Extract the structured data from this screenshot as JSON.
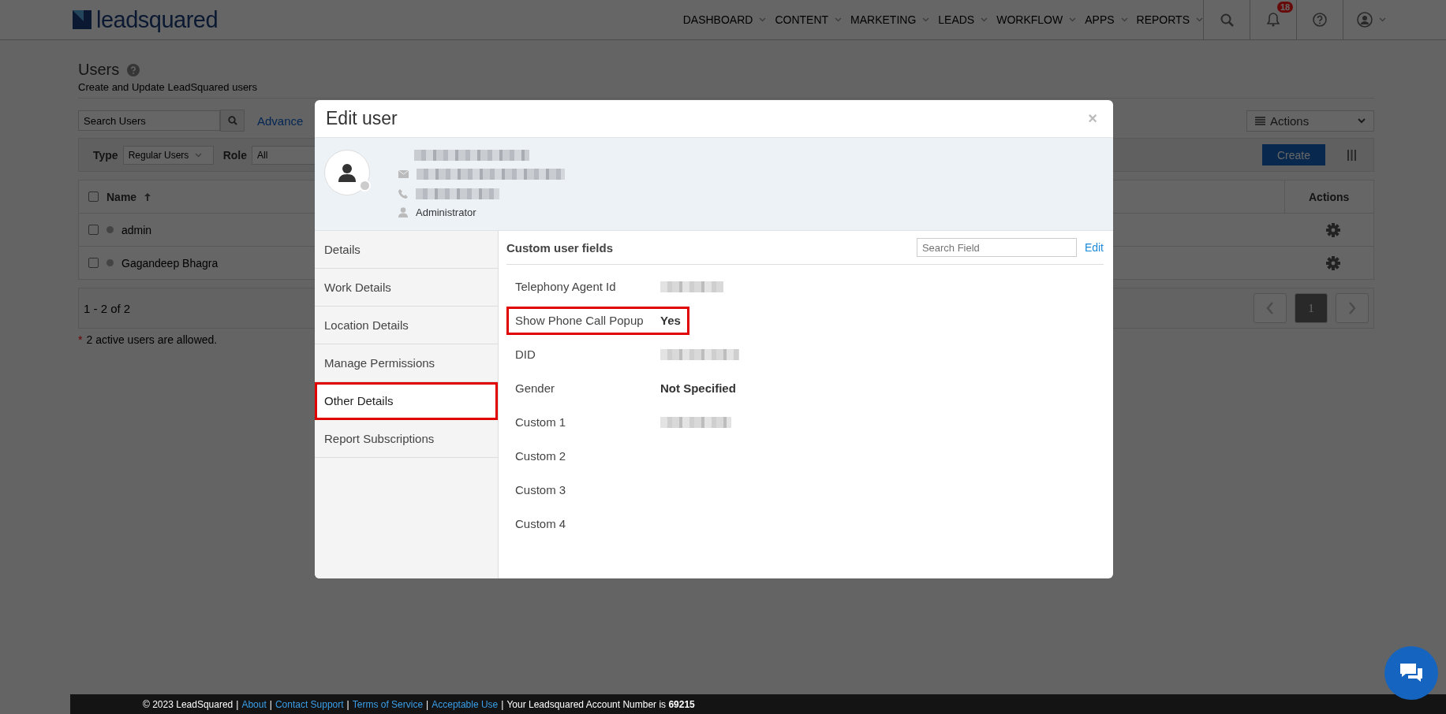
{
  "nav": {
    "brand": "leadsquared",
    "items": [
      {
        "label": "DASHBOARD"
      },
      {
        "label": "CONTENT"
      },
      {
        "label": "MARKETING"
      },
      {
        "label": "LEADS"
      },
      {
        "label": "WORKFLOW"
      },
      {
        "label": "APPS"
      },
      {
        "label": "REPORTS"
      }
    ],
    "notifications": "18"
  },
  "page": {
    "title": "Users",
    "subtitle": "Create and Update LeadSquared users",
    "search": {
      "placeholder": "Search Users"
    },
    "advanced_link": "Advance",
    "actions_menu": "Actions",
    "filters": [
      {
        "label": "Type",
        "value": "Regular Users"
      },
      {
        "label": "Role",
        "value": "All"
      }
    ],
    "create_button": "Create",
    "table": {
      "select_all": {
        "checked": false
      },
      "columns": [
        "Name",
        "Actions"
      ],
      "rows": [
        {
          "name": "admin",
          "checked": false
        },
        {
          "name": "Gagandeep Bhagra",
          "checked": false
        }
      ]
    },
    "range": "1 - 2 of 2",
    "pages": [
      {
        "label": "1",
        "selected": true
      }
    ],
    "note_mark": "*",
    "note": "2 active users are allowed."
  },
  "modal": {
    "title": "Edit user",
    "close": "×",
    "profile": {
      "lines": [
        {
          "kind": "name",
          "redacted": true
        },
        {
          "kind": "email",
          "redacted": true
        },
        {
          "kind": "phone",
          "redacted": true
        },
        {
          "kind": "role",
          "redacted": false,
          "text": "Administrator"
        }
      ]
    },
    "tabs": [
      {
        "label": "Details",
        "selected": false,
        "highlighted": false
      },
      {
        "label": "Work Details",
        "selected": false,
        "highlighted": false
      },
      {
        "label": "Location Details",
        "selected": false,
        "highlighted": false
      },
      {
        "label": "Manage Permissions",
        "selected": false,
        "highlighted": false
      },
      {
        "label": "Other Details",
        "selected": true,
        "highlighted": true
      },
      {
        "label": "Report Subscriptions",
        "selected": false,
        "highlighted": false
      }
    ],
    "panel": {
      "title": "Custom user fields",
      "search": {
        "placeholder": "Search Field"
      },
      "edit_link": "Edit",
      "fields": [
        {
          "label": "Telephony Agent Id",
          "kind": "redacted",
          "highlighted": false
        },
        {
          "label": "Show Phone Call Popup",
          "kind": "text",
          "value": "Yes",
          "highlighted": true
        },
        {
          "label": "DID",
          "kind": "redacted",
          "highlighted": false
        },
        {
          "label": "Gender",
          "kind": "text",
          "value": "Not Specified",
          "highlighted": false
        },
        {
          "label": "Custom 1",
          "kind": "redacted",
          "highlighted": false
        },
        {
          "label": "Custom 2",
          "kind": "empty",
          "highlighted": false
        },
        {
          "label": "Custom 3",
          "kind": "empty",
          "highlighted": false
        },
        {
          "label": "Custom 4",
          "kind": "empty",
          "highlighted": false
        }
      ]
    }
  },
  "footer": {
    "copyright": "© 2023 LeadSquared",
    "separator": "|",
    "links": [
      "About",
      "Contact Support",
      "Terms of Service",
      "Acceptable Use"
    ],
    "account_text": "Your Leadsquared Account Number is",
    "account_number": "69215"
  }
}
